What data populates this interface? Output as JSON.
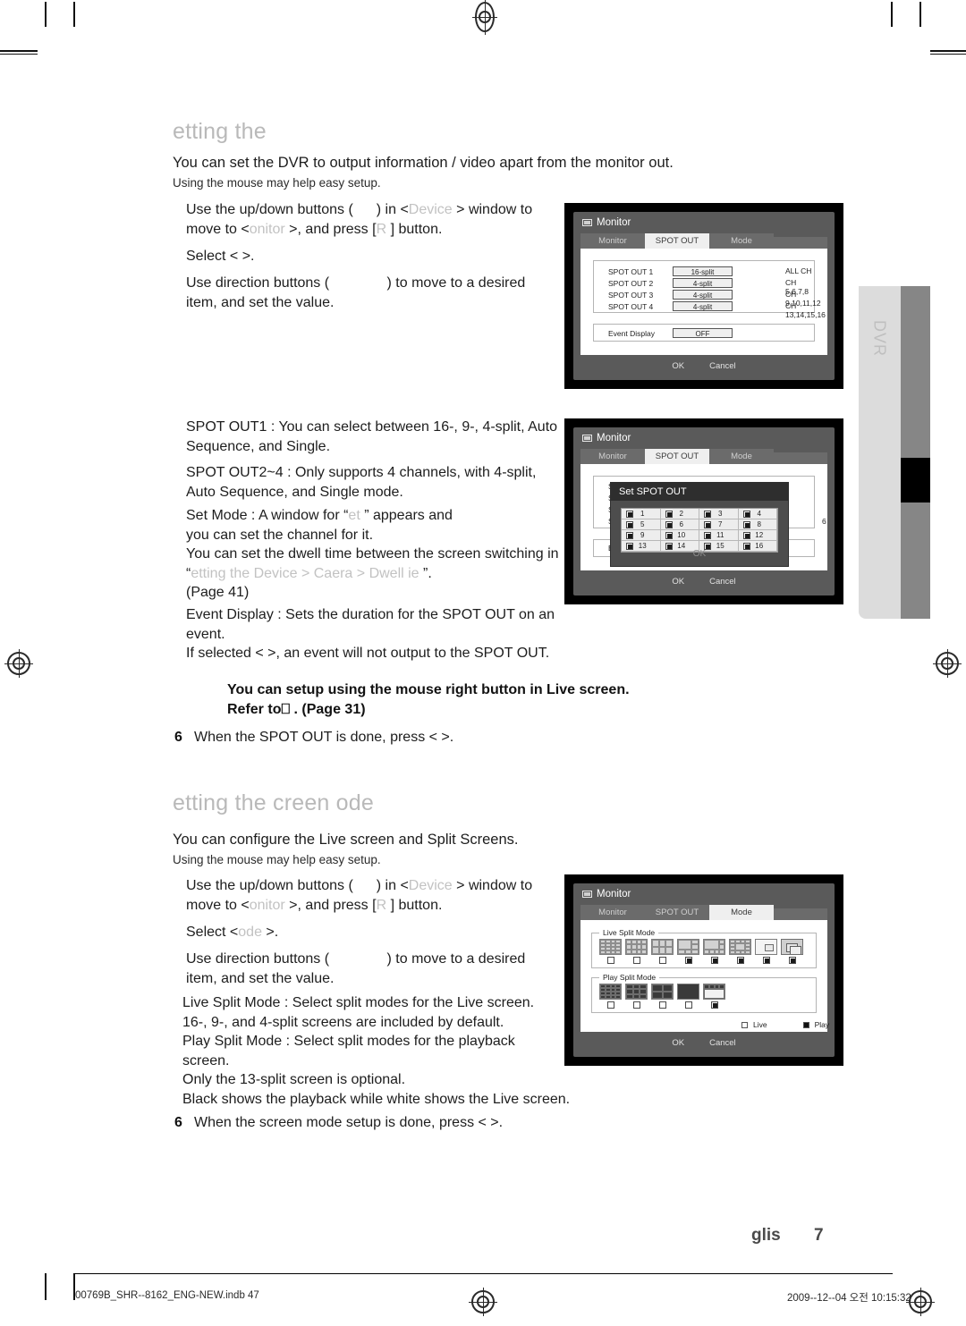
{
  "document": {
    "page_label": "glis",
    "page_number": "7",
    "footer_file": "00769B_SHR--8162_ENG-NEW.indb   47",
    "footer_date": "2009--12--04   오전 10:15:32"
  },
  "side_tab": {
    "label": "DVR"
  },
  "section1": {
    "title": "etting the",
    "intro": "You can set the DVR to output information / video apart from the monitor out.",
    "mouse_note": "Using the mouse may help easy setup.",
    "steps": [
      {
        "l1a": "Use the up/down buttons (",
        "l1b": ") in <",
        "l1c": "Device",
        "l1d": " > window to",
        "l2a": "move to <",
        "l2b": "onitor",
        "l2c": "  >, and press [",
        "l2d": "R",
        "l2e": "      ] button."
      },
      {
        "l1a": "Select <",
        "l1b": "",
        "l1c": "               >."
      },
      {
        "l1a": "Use direction buttons (",
        "l1b": "          ) to move to a desired",
        "l2a": "item, and set the value."
      }
    ],
    "bullets": [
      "SPOT OUT1 : You can select between 16-, 9-, 4-split, Auto",
      "Sequence, and Single.",
      "SPOT OUT2~4 : Only supports 4 channels, with 4-split,",
      "Auto Sequence, and Single mode."
    ],
    "setmode": {
      "l1a": "Set Mode : A window for “",
      "l1b": "et",
      "l1c": "                  ” appears and",
      "l2": "you can set the channel for it.",
      "l3": "You can set the dwell time between the screen switching in",
      "l4a": "“",
      "l4b": "etting the Device",
      "l4c": "   > ",
      "l4d": "Caera",
      "l4e": "   > ",
      "l4f": "Dwell ie",
      "l4g": "              ”.",
      "l5": "(Page 41)"
    },
    "eventdisp": {
      "l1": "Event Display : Sets the duration for the SPOT OUT on an",
      "l2": "event.",
      "l3a": "If selected <",
      "l3b": "      >, an event will not output to the SPOT OUT."
    },
    "note": {
      "l1": "You can setup using the mouse right button in Live screen.",
      "l2a": "Refer t",
      "l2b": "o⎕",
      "l2c": "         . (Page 31)"
    },
    "final_step": {
      "num": "6",
      "text": "When the SPOT OUT is done, press <     >."
    }
  },
  "section2": {
    "title": "etting the creen ode",
    "intro": "You can configure the Live screen and Split Screens.",
    "mouse_note": "Using the mouse may help easy setup.",
    "steps": [
      {
        "l1a": "Use the up/down buttons (",
        "l1b": ") in <",
        "l1c": "Device",
        "l1d": " > window to",
        "l2a": "move to <",
        "l2b": "onitor",
        "l2c": "  >, and press [",
        "l2d": "R",
        "l2e": "      ] button."
      },
      {
        "l1a": "Select <",
        "l1b": "ode",
        "l1c": "   >."
      },
      {
        "l1a": "Use direction buttons (",
        "l1b": "          ) to move to a desired",
        "l2a": "item, and set the value."
      }
    ],
    "bullets": [
      "Live Split Mode : Select split modes for the Live screen.",
      "16-, 9-, and 4-split screens are included by default.",
      "Play Split Mode : Select split modes for the playback",
      "screen.",
      "Only the 13-split screen is optional.",
      "Black shows the playback while white shows the Live screen."
    ],
    "final_step": {
      "num": "6",
      "text": "When the screen mode setup is done, press <     >."
    }
  },
  "dvr1": {
    "window_title": "Monitor",
    "tabs": [
      {
        "label": "Monitor",
        "selected": false
      },
      {
        "label": "SPOT OUT",
        "selected": true
      },
      {
        "label": "Mode",
        "selected": false
      }
    ],
    "spot_rows": [
      {
        "label": "SPOT OUT 1",
        "value": "16-split",
        "channels": "ALL CH"
      },
      {
        "label": "SPOT OUT 2",
        "value": "4-split",
        "channels": "CH 5,6,7,8"
      },
      {
        "label": "SPOT OUT 3",
        "value": "4-split",
        "channels": "CH 9,10,11,12"
      },
      {
        "label": "SPOT OUT 4",
        "value": "4-split",
        "channels": "CH 13,14,15,16"
      }
    ],
    "event_display": {
      "label": "Event Display",
      "value": "OFF"
    },
    "ok": "OK",
    "cancel": "Cancel"
  },
  "dvr2": {
    "window_title": "Monitor",
    "tabs": [
      {
        "label": "Monitor",
        "selected": false
      },
      {
        "label": "SPOT OUT",
        "selected": true
      },
      {
        "label": "Mode",
        "selected": false
      }
    ],
    "behind_rows": [
      "SPO",
      "SPO",
      "SPO",
      "SPO"
    ],
    "behind_event": "Eve",
    "behind_ch": "6",
    "modal": {
      "title": "Set SPOT OUT",
      "channels": [
        {
          "num": "1",
          "checked": true
        },
        {
          "num": "2",
          "checked": true
        },
        {
          "num": "3",
          "checked": true
        },
        {
          "num": "4",
          "checked": true
        },
        {
          "num": "5",
          "checked": true
        },
        {
          "num": "6",
          "checked": true
        },
        {
          "num": "7",
          "checked": true
        },
        {
          "num": "8",
          "checked": true
        },
        {
          "num": "9",
          "checked": true
        },
        {
          "num": "10",
          "checked": true
        },
        {
          "num": "11",
          "checked": true
        },
        {
          "num": "12",
          "checked": true
        },
        {
          "num": "13",
          "checked": true
        },
        {
          "num": "14",
          "checked": true
        },
        {
          "num": "15",
          "checked": true
        },
        {
          "num": "16",
          "checked": true
        }
      ],
      "ok": "OK"
    },
    "ok": "OK",
    "cancel": "Cancel"
  },
  "dvr3": {
    "window_title": "Monitor",
    "tabs": [
      {
        "label": "Monitor",
        "selected": false
      },
      {
        "label": "SPOT OUT",
        "selected": false
      },
      {
        "label": "Mode",
        "selected": true
      }
    ],
    "live_split": {
      "legend": "Live Split Mode",
      "items": [
        {
          "icon": "split-16",
          "checked": false
        },
        {
          "icon": "split-12",
          "checked": false
        },
        {
          "icon": "split-9",
          "checked": false
        },
        {
          "icon": "split-8",
          "checked": true
        },
        {
          "icon": "split-7",
          "checked": true
        },
        {
          "icon": "split-13",
          "checked": true
        },
        {
          "icon": "split-pip",
          "checked": true
        },
        {
          "icon": "split-seq",
          "checked": true
        }
      ]
    },
    "play_split": {
      "legend": "Play Split Mode",
      "items": [
        {
          "icon": "split-16-dark",
          "checked": false
        },
        {
          "icon": "split-9-dark",
          "checked": false
        },
        {
          "icon": "split-4-dark",
          "checked": false
        },
        {
          "icon": "split-1-dark",
          "checked": false
        },
        {
          "icon": "split-pip-dark",
          "checked": true
        }
      ]
    },
    "legend": {
      "live": "Live",
      "play": "Play"
    },
    "ok": "OK",
    "cancel": "Cancel"
  }
}
